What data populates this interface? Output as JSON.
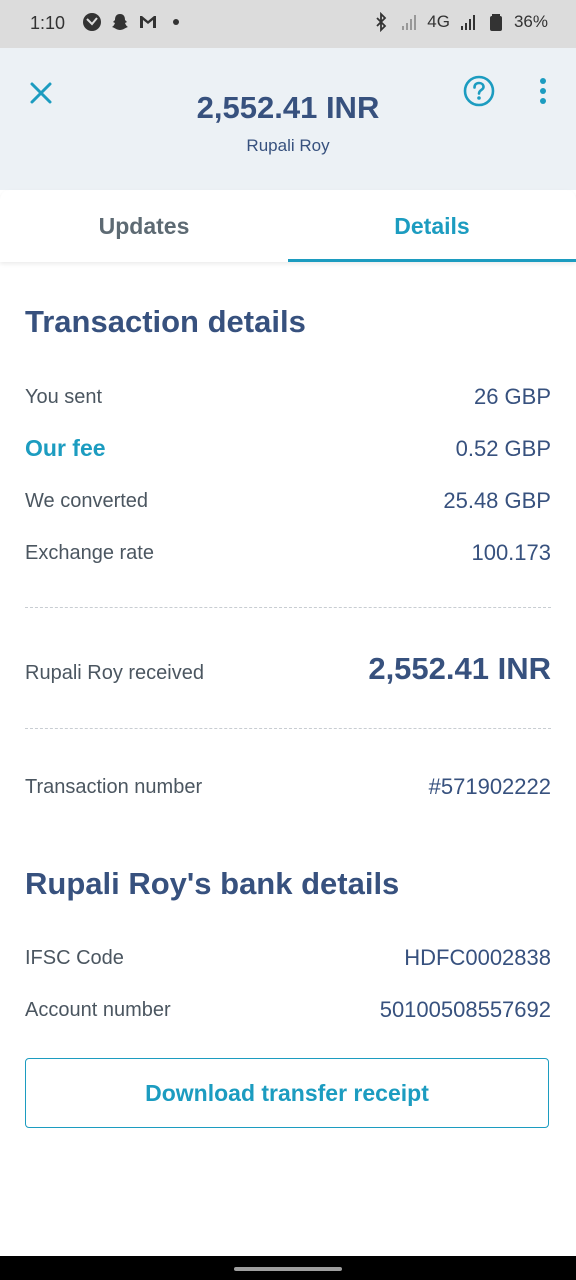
{
  "status_bar": {
    "time": "1:10",
    "network": "4G",
    "battery": "36%"
  },
  "header": {
    "amount": "2,552.41 INR",
    "recipient": "Rupali Roy",
    "icons": [
      "close-icon",
      "help-icon",
      "more-vert-icon"
    ]
  },
  "tabs": [
    {
      "label": "Updates",
      "active": false
    },
    {
      "label": "Details",
      "active": true
    }
  ],
  "transaction": {
    "title": "Transaction details",
    "rows": [
      {
        "label": "You sent",
        "value": "26 GBP"
      },
      {
        "label": "Our fee",
        "value": "0.52 GBP"
      },
      {
        "label": "We converted",
        "value": "25.48 GBP"
      },
      {
        "label": "Exchange rate",
        "value": "100.173"
      }
    ],
    "received_label": "Rupali Roy received",
    "received_value": "2,552.41 INR",
    "number_label": "Transaction number",
    "number_value": "#571902222"
  },
  "bank": {
    "title": "Rupali Roy's bank details",
    "rows": [
      {
        "label": "IFSC Code",
        "value": "HDFC0002838"
      },
      {
        "label": "Account number",
        "value": "50100508557692"
      }
    ]
  },
  "download_button": "Download transfer receipt",
  "colors": {
    "accent": "#1c9cc0",
    "text_dark": "#37517e",
    "header_bg": "#ecf1f5"
  }
}
